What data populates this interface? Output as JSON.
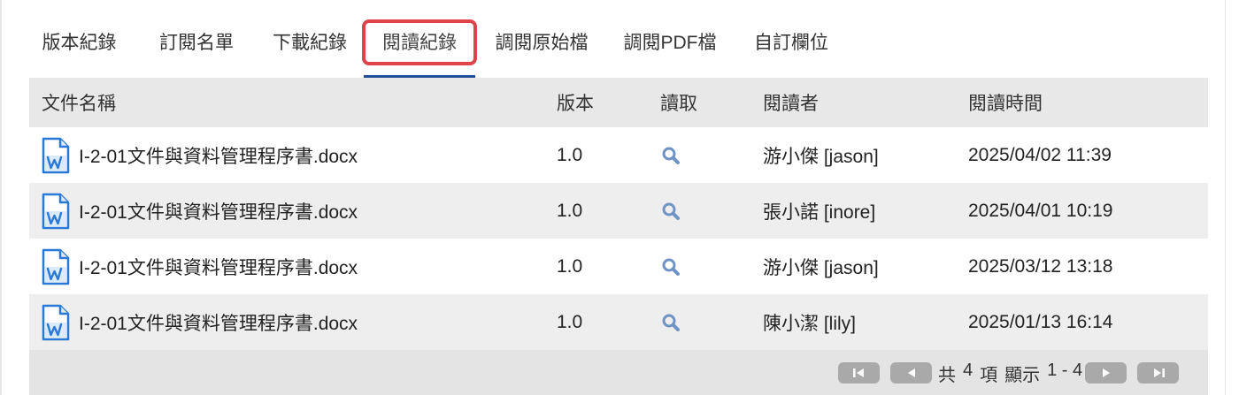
{
  "tabs": [
    {
      "label": "版本紀錄"
    },
    {
      "label": "訂閱名單"
    },
    {
      "label": "下載紀錄"
    },
    {
      "label": "閱讀紀錄",
      "active": true
    },
    {
      "label": "調閱原始檔"
    },
    {
      "label": "調閱PDF檔"
    },
    {
      "label": "自訂欄位"
    }
  ],
  "table": {
    "headers": {
      "name": "文件名稱",
      "version": "版本",
      "read": "讀取",
      "reader": "閱讀者",
      "time": "閱讀時間"
    },
    "rows": [
      {
        "name": "I-2-01文件與資料管理程序書.docx",
        "version": "1.0",
        "reader": "游小傑 [jason]",
        "time": "2025/04/02 11:39"
      },
      {
        "name": "I-2-01文件與資料管理程序書.docx",
        "version": "1.0",
        "reader": "張小諾 [inore]",
        "time": "2025/04/01 10:19"
      },
      {
        "name": "I-2-01文件與資料管理程序書.docx",
        "version": "1.0",
        "reader": "游小傑 [jason]",
        "time": "2025/03/12 13:18"
      },
      {
        "name": "I-2-01文件與資料管理程序書.docx",
        "version": "1.0",
        "reader": "陳小潔 [lily]",
        "time": "2025/01/13 16:14"
      }
    ]
  },
  "pager": {
    "total_prefix": "共",
    "total": "4",
    "total_suffix": "項",
    "display_label": "顯示",
    "range": "1 - 4"
  },
  "icons": {
    "doc": "word-document-icon",
    "read": "search-icon",
    "first": "first-page-icon",
    "prev": "prev-page-icon",
    "next": "next-page-icon",
    "last": "last-page-icon"
  },
  "colors": {
    "tab_underline": "#1f4e99",
    "highlight_border": "#e0424b",
    "doc_icon": "#2b79d6",
    "search_icon": "#6f93c4"
  }
}
